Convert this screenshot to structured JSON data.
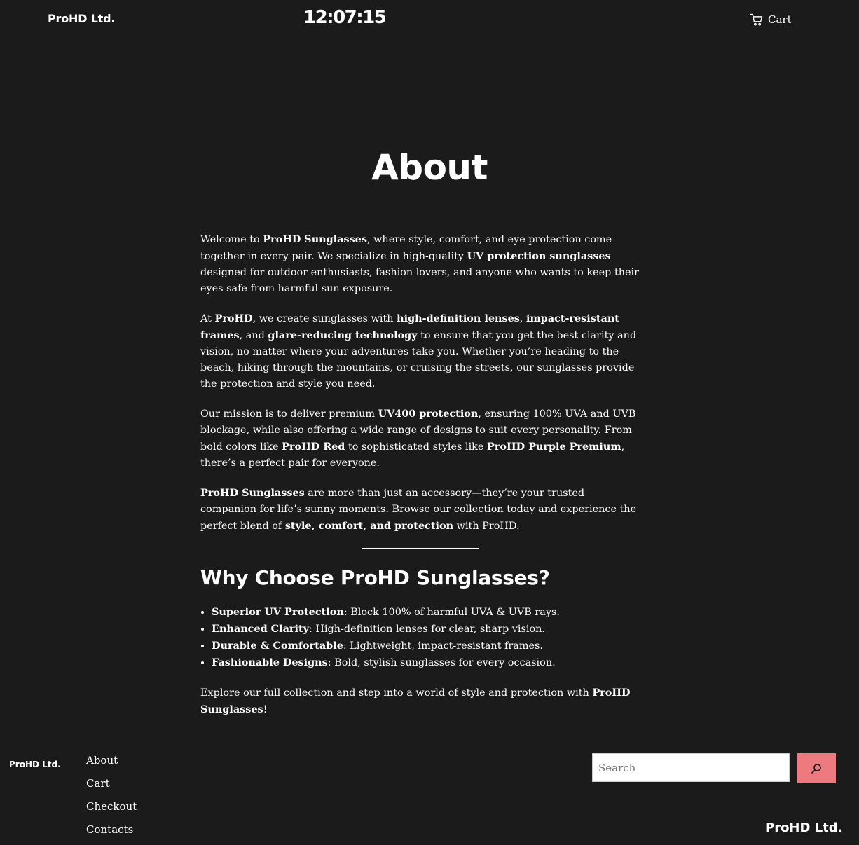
{
  "header": {
    "site_title": "ProHD Ltd.",
    "clock": "12:07:15",
    "cart_label": "Cart"
  },
  "main": {
    "title": "About",
    "p1": {
      "t1": "Welcome to ",
      "b1": "ProHD Sunglasses",
      "t2": ", where style, comfort, and eye protection come together in every pair. We specialize in high-quality ",
      "b2": "UV protection sunglasses",
      "t3": " designed for outdoor enthusiasts, fashion lovers, and anyone who wants to keep their eyes safe from harmful sun exposure."
    },
    "p2": {
      "t1": "At ",
      "b1": "ProHD",
      "t2": ", we create sunglasses with ",
      "b2": "high-definition lenses",
      "t3": ", ",
      "b3": "impact-resistant frames",
      "t4": ", and ",
      "b4": "glare-reducing technology",
      "t5": " to ensure that you get the best clarity and vision, no matter where your adventures take you. Whether you’re heading to the beach, hiking through the mountains, or cruising the streets, our sunglasses provide the protection and style you need."
    },
    "p3": {
      "t1": "Our mission is to deliver premium ",
      "b1": "UV400 protection",
      "t2": ", ensuring 100% UVA and UVB blockage, while also offering a wide range of designs to suit every personality. From bold colors like ",
      "b2": "ProHD Red",
      "t3": " to sophisticated styles like ",
      "b3": "ProHD Purple Premium",
      "t4": ", there’s a perfect pair for everyone."
    },
    "p4": {
      "b1": "ProHD Sunglasses",
      "t1": " are more than just an accessory—they’re your trusted companion for life’s sunny moments. Browse our collection today and experience the perfect blend of ",
      "b2": "style, comfort, and protection",
      "t2": " with ProHD."
    },
    "heading": "Why Choose ProHD Sunglasses?",
    "features": [
      {
        "title": "Superior UV Protection",
        "text": ": Block 100% of harmful UVA & UVB rays."
      },
      {
        "title": "Enhanced Clarity",
        "text": ": High-definition lenses for clear, sharp vision."
      },
      {
        "title": "Durable & Comfortable",
        "text": ": Lightweight, impact-resistant frames."
      },
      {
        "title": "Fashionable Designs",
        "text": ": Bold, stylish sunglasses for every occasion."
      }
    ],
    "closing": {
      "t1": "Explore our full collection and step into a world of style and protection with ",
      "b1": "ProHD Sunglasses",
      "t2": "!"
    }
  },
  "footer": {
    "logo": "ProHD Ltd.",
    "nav": [
      "About",
      "Cart",
      "Checkout",
      "Contacts"
    ],
    "search_placeholder": "Search",
    "brand": "ProHD Ltd."
  },
  "colors": {
    "background": "#1b1b1b",
    "text": "#ffffff",
    "search_button": "#ec7a7e"
  },
  "icons": {
    "cart": "cart-icon",
    "search": "search-icon"
  }
}
